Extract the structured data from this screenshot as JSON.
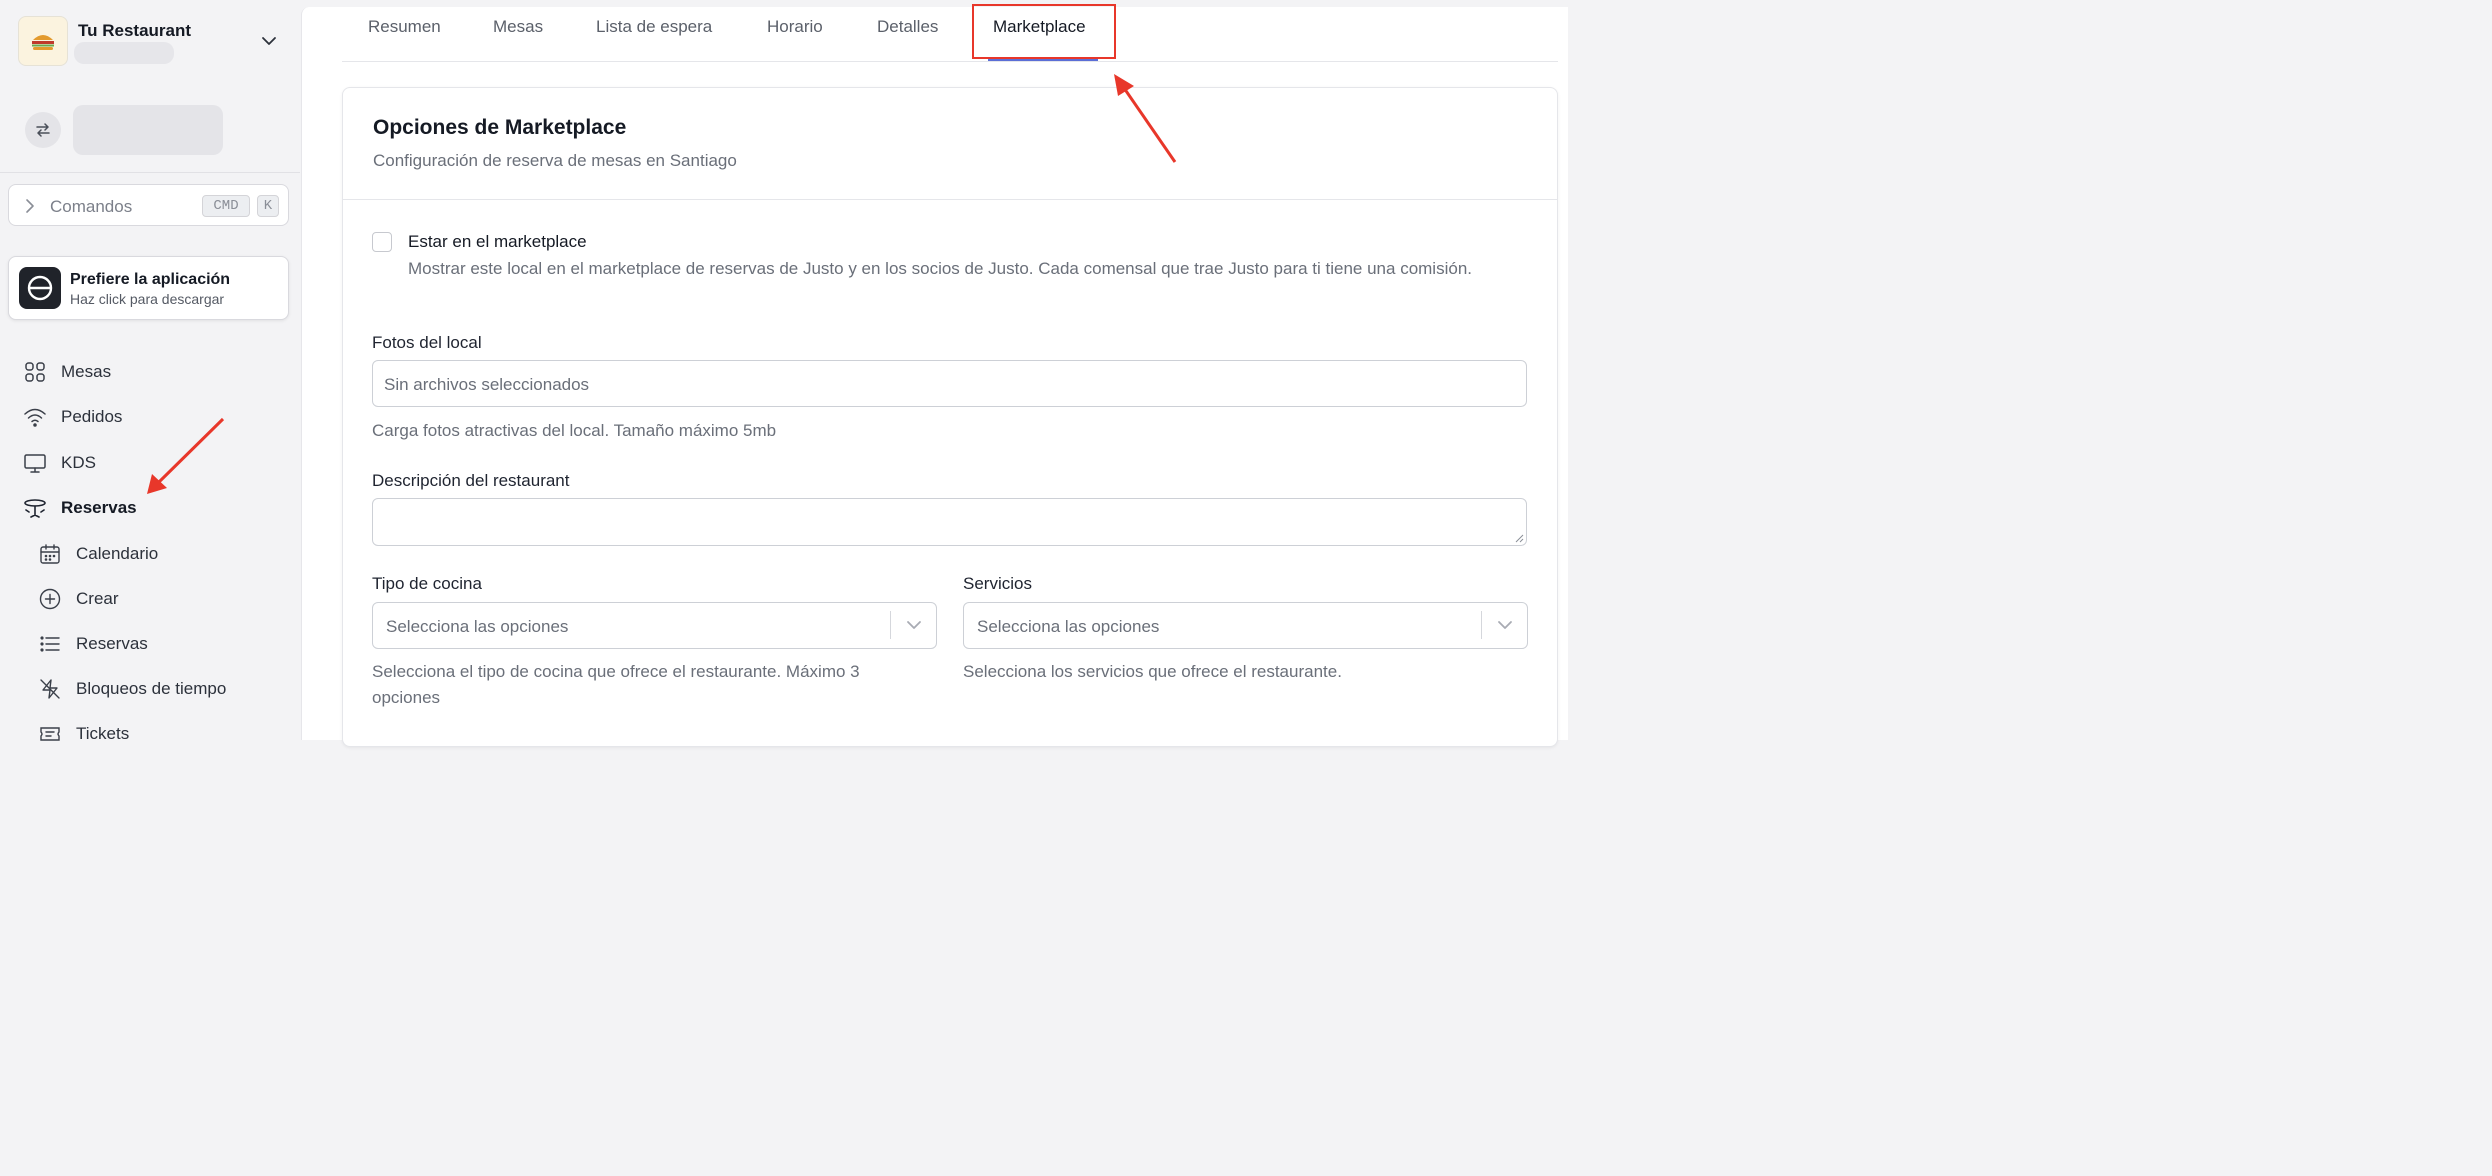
{
  "brand": {
    "name": "Tu Restaurant"
  },
  "commands": {
    "label": "Comandos",
    "key_cmd": "CMD",
    "key_k": "K"
  },
  "app_promo": {
    "title": "Prefiere la aplicación",
    "subtitle": "Haz click para descargar"
  },
  "sidebar": {
    "items": [
      {
        "label": "Mesas",
        "icon": "grid-icon"
      },
      {
        "label": "Pedidos",
        "icon": "wifi-icon"
      },
      {
        "label": "KDS",
        "icon": "monitor-icon"
      },
      {
        "label": "Reservas",
        "icon": "table-icon",
        "active": true
      }
    ],
    "subitems": [
      {
        "label": "Calendario",
        "icon": "calendar-icon"
      },
      {
        "label": "Crear",
        "icon": "plus-circle-icon"
      },
      {
        "label": "Reservas",
        "icon": "list-icon"
      },
      {
        "label": "Bloqueos de tiempo",
        "icon": "zap-off-icon"
      },
      {
        "label": "Tickets",
        "icon": "ticket-icon"
      }
    ]
  },
  "tabs": [
    {
      "label": "Resumen"
    },
    {
      "label": "Mesas"
    },
    {
      "label": "Lista de espera"
    },
    {
      "label": "Horario"
    },
    {
      "label": "Detalles"
    },
    {
      "label": "Marketplace",
      "active": true
    }
  ],
  "card": {
    "title": "Opciones de Marketplace",
    "subtitle": "Configuración de reserva de mesas en Santiago",
    "marketplace_checkbox": {
      "label": "Estar en el marketplace",
      "description": "Mostrar este local en el marketplace de reservas de Justo y en los socios de Justo. Cada comensal que trae Justo para ti tiene una comisión.",
      "checked": false
    },
    "photos": {
      "label": "Fotos del local",
      "value": "Sin archivos seleccionados",
      "help": "Carga fotos atractivas del local. Tamaño máximo 5mb"
    },
    "description": {
      "label": "Descripción del restaurant",
      "value": ""
    },
    "cuisine": {
      "label": "Tipo de cocina",
      "placeholder": "Selecciona las opciones",
      "help": "Selecciona el tipo de cocina que ofrece el restaurante. Máximo 3 opciones"
    },
    "services": {
      "label": "Servicios",
      "placeholder": "Selecciona las opciones",
      "help": "Selecciona los servicios que ofrece el restaurante."
    }
  },
  "colors": {
    "accent": "#5b6ed6",
    "annotation": "#e8372a"
  }
}
